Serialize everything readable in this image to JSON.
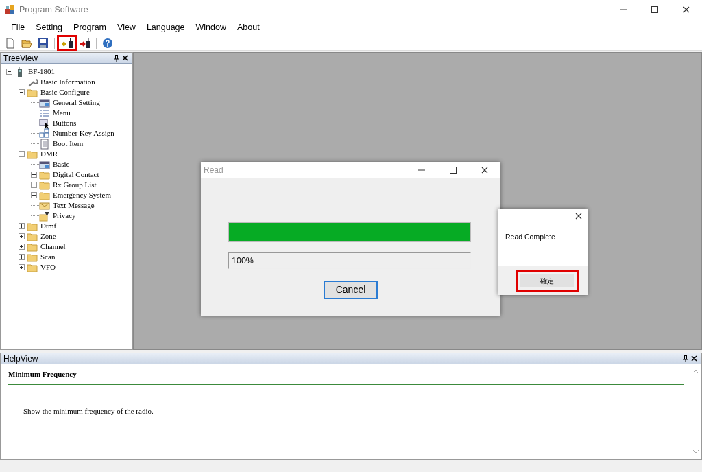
{
  "window": {
    "title": "Program Software"
  },
  "menu": [
    "File",
    "Setting",
    "Program",
    "View",
    "Language",
    "Window",
    "About"
  ],
  "toolbar": [
    {
      "kind": "new",
      "highlighted": false
    },
    {
      "kind": "open",
      "highlighted": false
    },
    {
      "kind": "save",
      "highlighted": false
    },
    {
      "kind": "read",
      "highlighted": true
    },
    {
      "kind": "write",
      "highlighted": false
    },
    {
      "kind": "help",
      "highlighted": false
    }
  ],
  "treeview": {
    "title": "TreeView",
    "items": [
      {
        "label": "BF-1801",
        "kind": "device",
        "expanded": true,
        "children": [
          {
            "label": "Basic Information",
            "kind": "info"
          },
          {
            "label": "Basic Configure",
            "kind": "folder",
            "expanded": true,
            "children": [
              {
                "label": "General Setting",
                "kind": "settings"
              },
              {
                "label": "Menu",
                "kind": "list"
              },
              {
                "label": "Buttons",
                "kind": "buttons"
              },
              {
                "label": "Number Key Assign",
                "kind": "keys"
              },
              {
                "label": "Boot Item",
                "kind": "page"
              }
            ]
          },
          {
            "label": "DMR",
            "kind": "folder",
            "expanded": true,
            "children": [
              {
                "label": "Basic",
                "kind": "settings"
              },
              {
                "label": "Digital Contact",
                "kind": "folder",
                "expanded": false
              },
              {
                "label": "Rx Group List",
                "kind": "folder",
                "expanded": false
              },
              {
                "label": "Emergency System",
                "kind": "folder",
                "expanded": false
              },
              {
                "label": "Text Message",
                "kind": "message"
              },
              {
                "label": "Privacy",
                "kind": "privacy"
              }
            ]
          },
          {
            "label": "Dtmf",
            "kind": "folder",
            "expanded": false
          },
          {
            "label": "Zone",
            "kind": "folder",
            "expanded": false
          },
          {
            "label": "Channel",
            "kind": "folder",
            "expanded": false
          },
          {
            "label": "Scan",
            "kind": "folder",
            "expanded": false
          },
          {
            "label": "VFO",
            "kind": "folder",
            "expanded": false
          }
        ]
      }
    ]
  },
  "read_dialog": {
    "title": "Read",
    "level": 1.0,
    "progress_text": "100%",
    "button": "Cancel"
  },
  "message_box": {
    "message": "Read Complete",
    "button": "確定",
    "highlighted": true
  },
  "helpview": {
    "title": "HelpView",
    "heading": "Minimum Frequency",
    "text": "Show the minimum frequency of the radio."
  }
}
